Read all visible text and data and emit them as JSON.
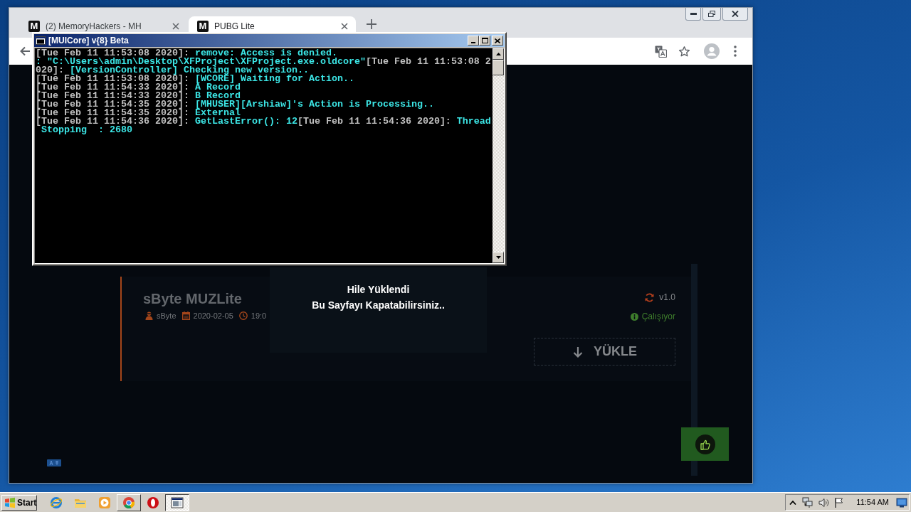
{
  "browser": {
    "tabs": [
      {
        "logo": "M",
        "title": "(2) MemoryHackers - MH",
        "selected": false
      },
      {
        "logo": "M",
        "title": "PUBG Lite",
        "selected": true
      }
    ]
  },
  "console": {
    "title": "[MUICore] v{8} Beta",
    "lines": [
      {
        "segments": [
          {
            "kind": "timestamp",
            "text": "[Tue Feb 11 11:53:08 2020]:"
          },
          {
            "kind": "message",
            "text": " remove: Access is denied."
          }
        ]
      },
      {
        "segments": [
          {
            "kind": "message",
            "text": ": \"C:\\Users\\admin\\Desktop\\XFProject\\XFProject.exe.oldcore\""
          },
          {
            "kind": "timestamp",
            "text": "[Tue Feb 11 11:53:08 2"
          }
        ]
      },
      {
        "segments": [
          {
            "kind": "timestamp",
            "text": "020]:"
          },
          {
            "kind": "message",
            "text": " [VersionController] Checking new version.."
          }
        ]
      },
      {
        "segments": [
          {
            "kind": "timestamp",
            "text": "[Tue Feb 11 11:53:08 2020]:"
          },
          {
            "kind": "message",
            "text": " [WCORE] Waiting for Action.."
          }
        ]
      },
      {
        "segments": [
          {
            "kind": "timestamp",
            "text": "[Tue Feb 11 11:54:33 2020]:"
          },
          {
            "kind": "message",
            "text": " A Record"
          }
        ]
      },
      {
        "segments": [
          {
            "kind": "timestamp",
            "text": "[Tue Feb 11 11:54:33 2020]:"
          },
          {
            "kind": "message",
            "text": " B Record"
          }
        ]
      },
      {
        "segments": [
          {
            "kind": "timestamp",
            "text": "[Tue Feb 11 11:54:35 2020]:"
          },
          {
            "kind": "message",
            "text": " [MHUSER][Arshiaw]'s Action is Processing.."
          }
        ]
      },
      {
        "segments": [
          {
            "kind": "timestamp",
            "text": "[Tue Feb 11 11:54:35 2020]:"
          },
          {
            "kind": "message",
            "text": " External"
          }
        ]
      },
      {
        "segments": [
          {
            "kind": "timestamp",
            "text": "[Tue Feb 11 11:54:36 2020]:"
          },
          {
            "kind": "message",
            "text": " GetLastError(): 12"
          },
          {
            "kind": "timestamp",
            "text": "[Tue Feb 11 11:54:36 2020]:"
          },
          {
            "kind": "message",
            "text": " Thread"
          }
        ]
      },
      {
        "segments": [
          {
            "kind": "message",
            "text": " Stopping  : 2680"
          }
        ]
      }
    ]
  },
  "page": {
    "card": {
      "title": "sByte MUZLite",
      "author": "sByte",
      "date": "2020-02-05",
      "time": "19:0",
      "version": "v1.0",
      "status": "Çalışıyor",
      "action": "YÜKLE"
    },
    "notice": [
      "Hile Yüklendi",
      "Bu Sayfayı Kapatabilirsiniz.."
    ]
  },
  "taskbar": {
    "start": "Start",
    "apps": [
      {
        "kind": "globe",
        "open": false,
        "selected": false
      },
      {
        "kind": "folder",
        "open": false,
        "selected": false
      },
      {
        "kind": "player",
        "open": false,
        "selected": false
      },
      {
        "kind": "round",
        "open": true,
        "selected": false
      },
      {
        "kind": "ring",
        "open": false,
        "selected": false
      },
      {
        "kind": "console",
        "open": true,
        "selected": true
      }
    ],
    "clock": "11:54 AM"
  }
}
